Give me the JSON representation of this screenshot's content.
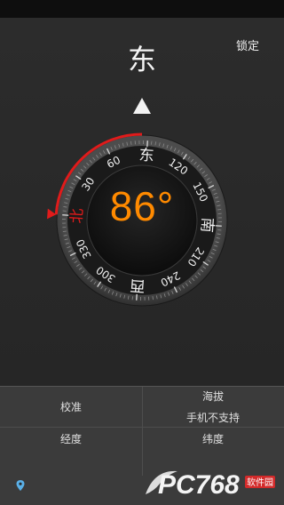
{
  "header": {
    "direction": "东",
    "lock_label": "锁定"
  },
  "compass": {
    "degree_text": "86°",
    "heading_degrees": 86,
    "ring_labels": [
      "北",
      "30",
      "60",
      "东",
      "120",
      "150",
      "南",
      "210",
      "240",
      "西",
      "300",
      "330"
    ],
    "accent_color": "#ff8a00",
    "north_color": "#e01b1b"
  },
  "info": {
    "calibrate_label": "校准",
    "altitude_label": "海拔",
    "altitude_value": "手机不支持",
    "longitude_label": "经度",
    "latitude_label": "纬度"
  },
  "watermark": {
    "logo_text": "PC768",
    "tag": "软件园"
  },
  "icons": {
    "location": "map-pin-icon",
    "pointer": "triangle-pointer-icon"
  }
}
